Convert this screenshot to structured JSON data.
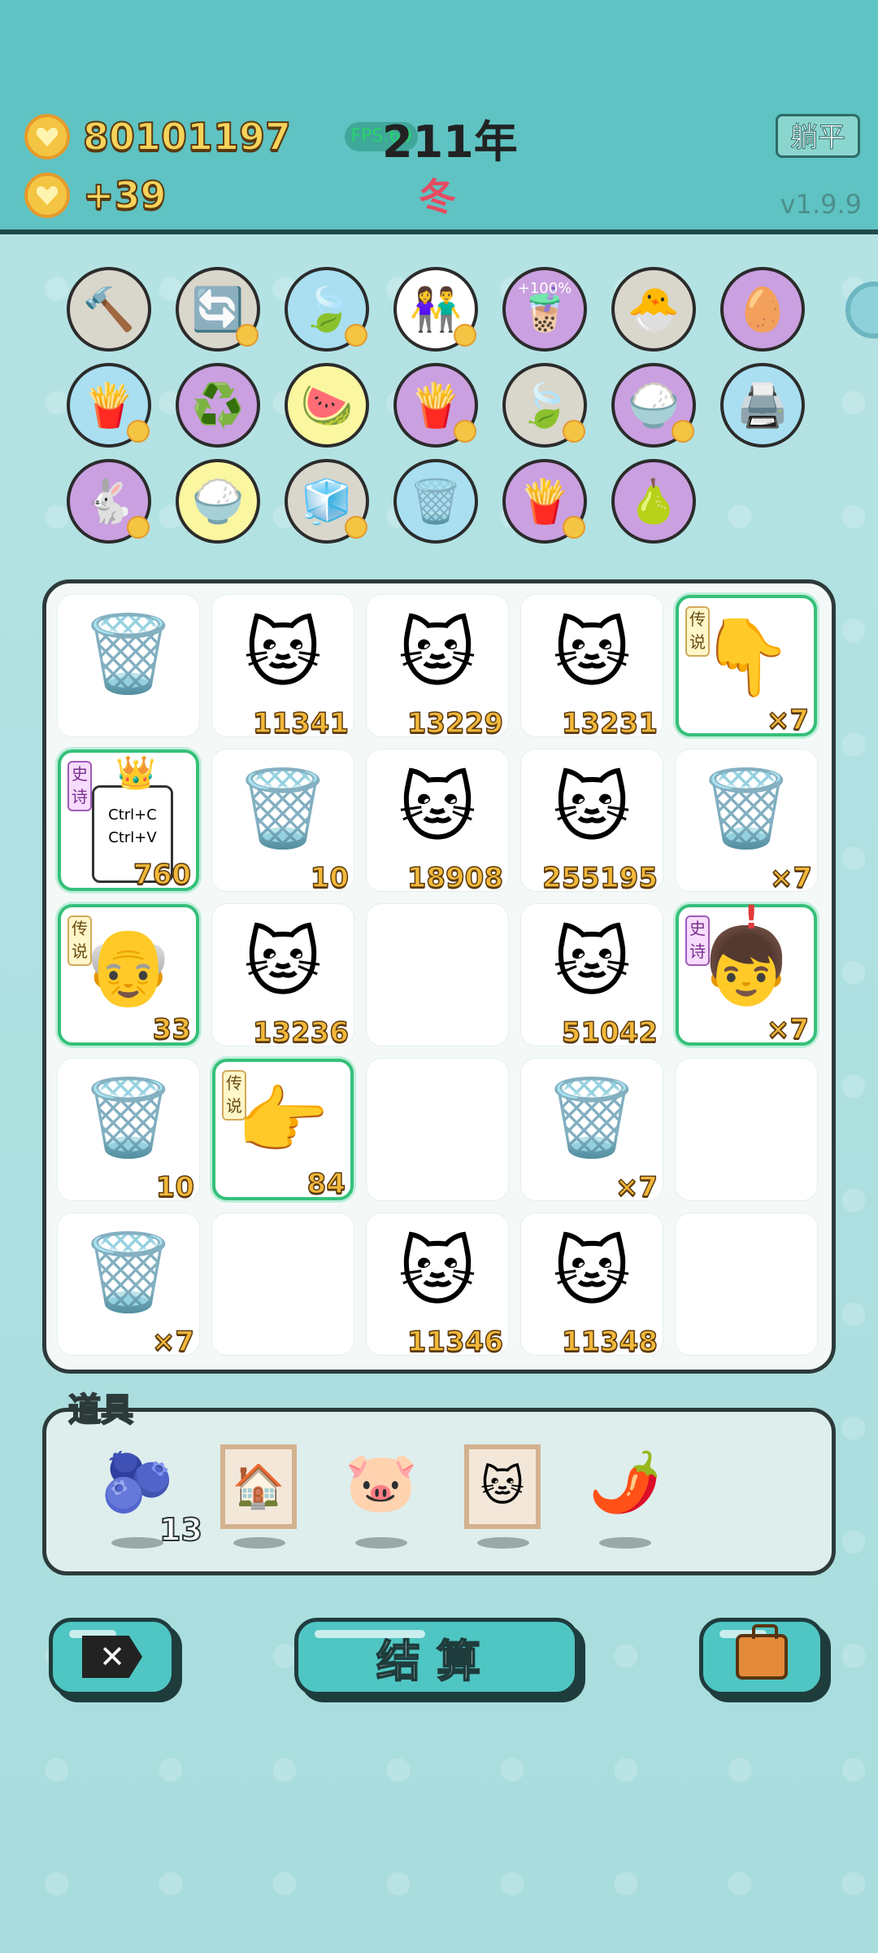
{
  "header": {
    "coins_total": "80101197",
    "coins_rate": "+39",
    "fps_label": "FPS:60",
    "year": "211年",
    "season": "冬",
    "flat_button": "躺平",
    "version": "v1.9.9"
  },
  "bubbles": [
    {
      "icon": "hammer-icon",
      "glyph": "🔨",
      "color": "gray",
      "badge": false
    },
    {
      "icon": "refresh-icon",
      "glyph": "🔄",
      "color": "gray",
      "badge": true
    },
    {
      "icon": "leaf-icon",
      "glyph": "🍃",
      "color": "blue",
      "badge": true
    },
    {
      "icon": "couple-icon",
      "glyph": "👫",
      "color": "white",
      "badge": true
    },
    {
      "icon": "milk-tea-icon",
      "glyph": "🧋",
      "color": "purple",
      "badge": false,
      "label": "+100%"
    },
    {
      "icon": "chick-egg-icon",
      "glyph": "🐣",
      "color": "gray",
      "badge": false
    },
    {
      "icon": "egg-icon",
      "glyph": "🥚",
      "color": "purple",
      "badge": false
    },
    {
      "icon": "fries-icon",
      "glyph": "🍟",
      "color": "blue",
      "badge": true
    },
    {
      "icon": "recycle-icon",
      "glyph": "♻️",
      "color": "purple",
      "badge": false
    },
    {
      "icon": "fruit-bowl-icon",
      "glyph": "🍉",
      "color": "yellow",
      "badge": false
    },
    {
      "icon": "fries-icon",
      "glyph": "🍟",
      "color": "purple",
      "badge": true
    },
    {
      "icon": "leaf-icon",
      "glyph": "🍃",
      "color": "gray",
      "badge": true
    },
    {
      "icon": "rice-bowl-icon",
      "glyph": "🍚",
      "color": "purple",
      "badge": true
    },
    {
      "icon": "printer-icon",
      "glyph": "🖨️",
      "color": "blue",
      "badge": false
    },
    {
      "icon": "rabbit-icon",
      "glyph": "🐇",
      "color": "purple",
      "badge": true
    },
    {
      "icon": "rice-bowl-icon",
      "glyph": "🍚",
      "color": "yellow",
      "badge": false
    },
    {
      "icon": "sugar-cubes-icon",
      "glyph": "🧊",
      "color": "gray",
      "badge": true
    },
    {
      "icon": "trash-recycle-icon",
      "glyph": "🗑️",
      "color": "blue",
      "badge": false
    },
    {
      "icon": "fries-icon",
      "glyph": "🍟",
      "color": "purple",
      "badge": true
    },
    {
      "icon": "guava-icon",
      "glyph": "🍐",
      "color": "purple",
      "badge": false
    }
  ],
  "board": [
    {
      "icon": "trash-bag-icon",
      "glyph": "🗑️",
      "num": ""
    },
    {
      "icon": "cat-icon",
      "glyph": "🐱",
      "num": "11341"
    },
    {
      "icon": "cat-icon",
      "glyph": "🐱",
      "num": "13229"
    },
    {
      "icon": "cat-icon",
      "glyph": "🐱",
      "num": "13231"
    },
    {
      "icon": "pointing-hand-icon",
      "glyph": "👇",
      "num": "×7",
      "tag": "传说",
      "legend": true
    },
    {
      "icon": "ctrl-c-v-icon",
      "glyph": "",
      "num": "760",
      "tag": "史诗",
      "tagPurple": true,
      "legend": true,
      "ctrl": true
    },
    {
      "icon": "trash-bag-icon",
      "glyph": "🗑️",
      "num": "10"
    },
    {
      "icon": "cat-icon",
      "glyph": "🐱",
      "num": "18908"
    },
    {
      "icon": "cat-icon",
      "glyph": "🐱",
      "num": "255195"
    },
    {
      "icon": "trash-bag-icon",
      "glyph": "🗑️",
      "num": "×7"
    },
    {
      "icon": "old-man-icon",
      "glyph": "👴",
      "num": "33",
      "tag": "传说",
      "legend": true
    },
    {
      "icon": "cat-icon",
      "glyph": "🐱",
      "num": "13236"
    },
    {
      "icon": "empty",
      "glyph": "",
      "num": ""
    },
    {
      "icon": "cat-icon",
      "glyph": "🐱",
      "num": "51042"
    },
    {
      "icon": "boy-red-hat-icon",
      "glyph": "👦",
      "num": "×7",
      "tag": "史诗",
      "tagPurple": true,
      "legend": true,
      "alert": true
    },
    {
      "icon": "trash-bag-icon",
      "glyph": "🗑️",
      "num": "10"
    },
    {
      "icon": "pointing-hand-icon",
      "glyph": "👉",
      "num": "84",
      "tag": "传说",
      "legend": true
    },
    {
      "icon": "empty",
      "glyph": "",
      "num": ""
    },
    {
      "icon": "trash-bag-icon",
      "glyph": "🗑️",
      "num": "×7"
    },
    {
      "icon": "empty",
      "glyph": "",
      "num": ""
    },
    {
      "icon": "trash-bag-icon",
      "glyph": "🗑️",
      "num": "×7"
    },
    {
      "icon": "empty",
      "glyph": "",
      "num": ""
    },
    {
      "icon": "cat-icon",
      "glyph": "🐱",
      "num": "11346"
    },
    {
      "icon": "cat-icon",
      "glyph": "🐱",
      "num": "11348"
    },
    {
      "icon": "empty",
      "glyph": "",
      "num": ""
    }
  ],
  "ctrl_text": {
    "line1": "Ctrl+C",
    "line2": "Ctrl+V"
  },
  "tools": {
    "label": "道具",
    "items": [
      {
        "icon": "blueberry-icon",
        "glyph": "🫐",
        "framed": false
      },
      {
        "icon": "windmill-picture-icon",
        "glyph": "🏠",
        "framed": true
      },
      {
        "icon": "piggy-bank-icon",
        "glyph": "🐷",
        "framed": false
      },
      {
        "icon": "cat-picture-icon",
        "glyph": "🐱",
        "framed": true
      },
      {
        "icon": "chili-pepper-icon",
        "glyph": "🌶️",
        "framed": false
      }
    ],
    "blueberry_count": "13"
  },
  "buttons": {
    "settle": "结算",
    "close_icon": "close-icon",
    "bag_icon": "briefcase-icon"
  },
  "colors": {
    "header_bg": "#5ec3c2",
    "body_bg": "#a9dfe1",
    "accent_number": "#f2b83a",
    "legend_border": "#35c07a",
    "season_red": "#e64b61"
  }
}
